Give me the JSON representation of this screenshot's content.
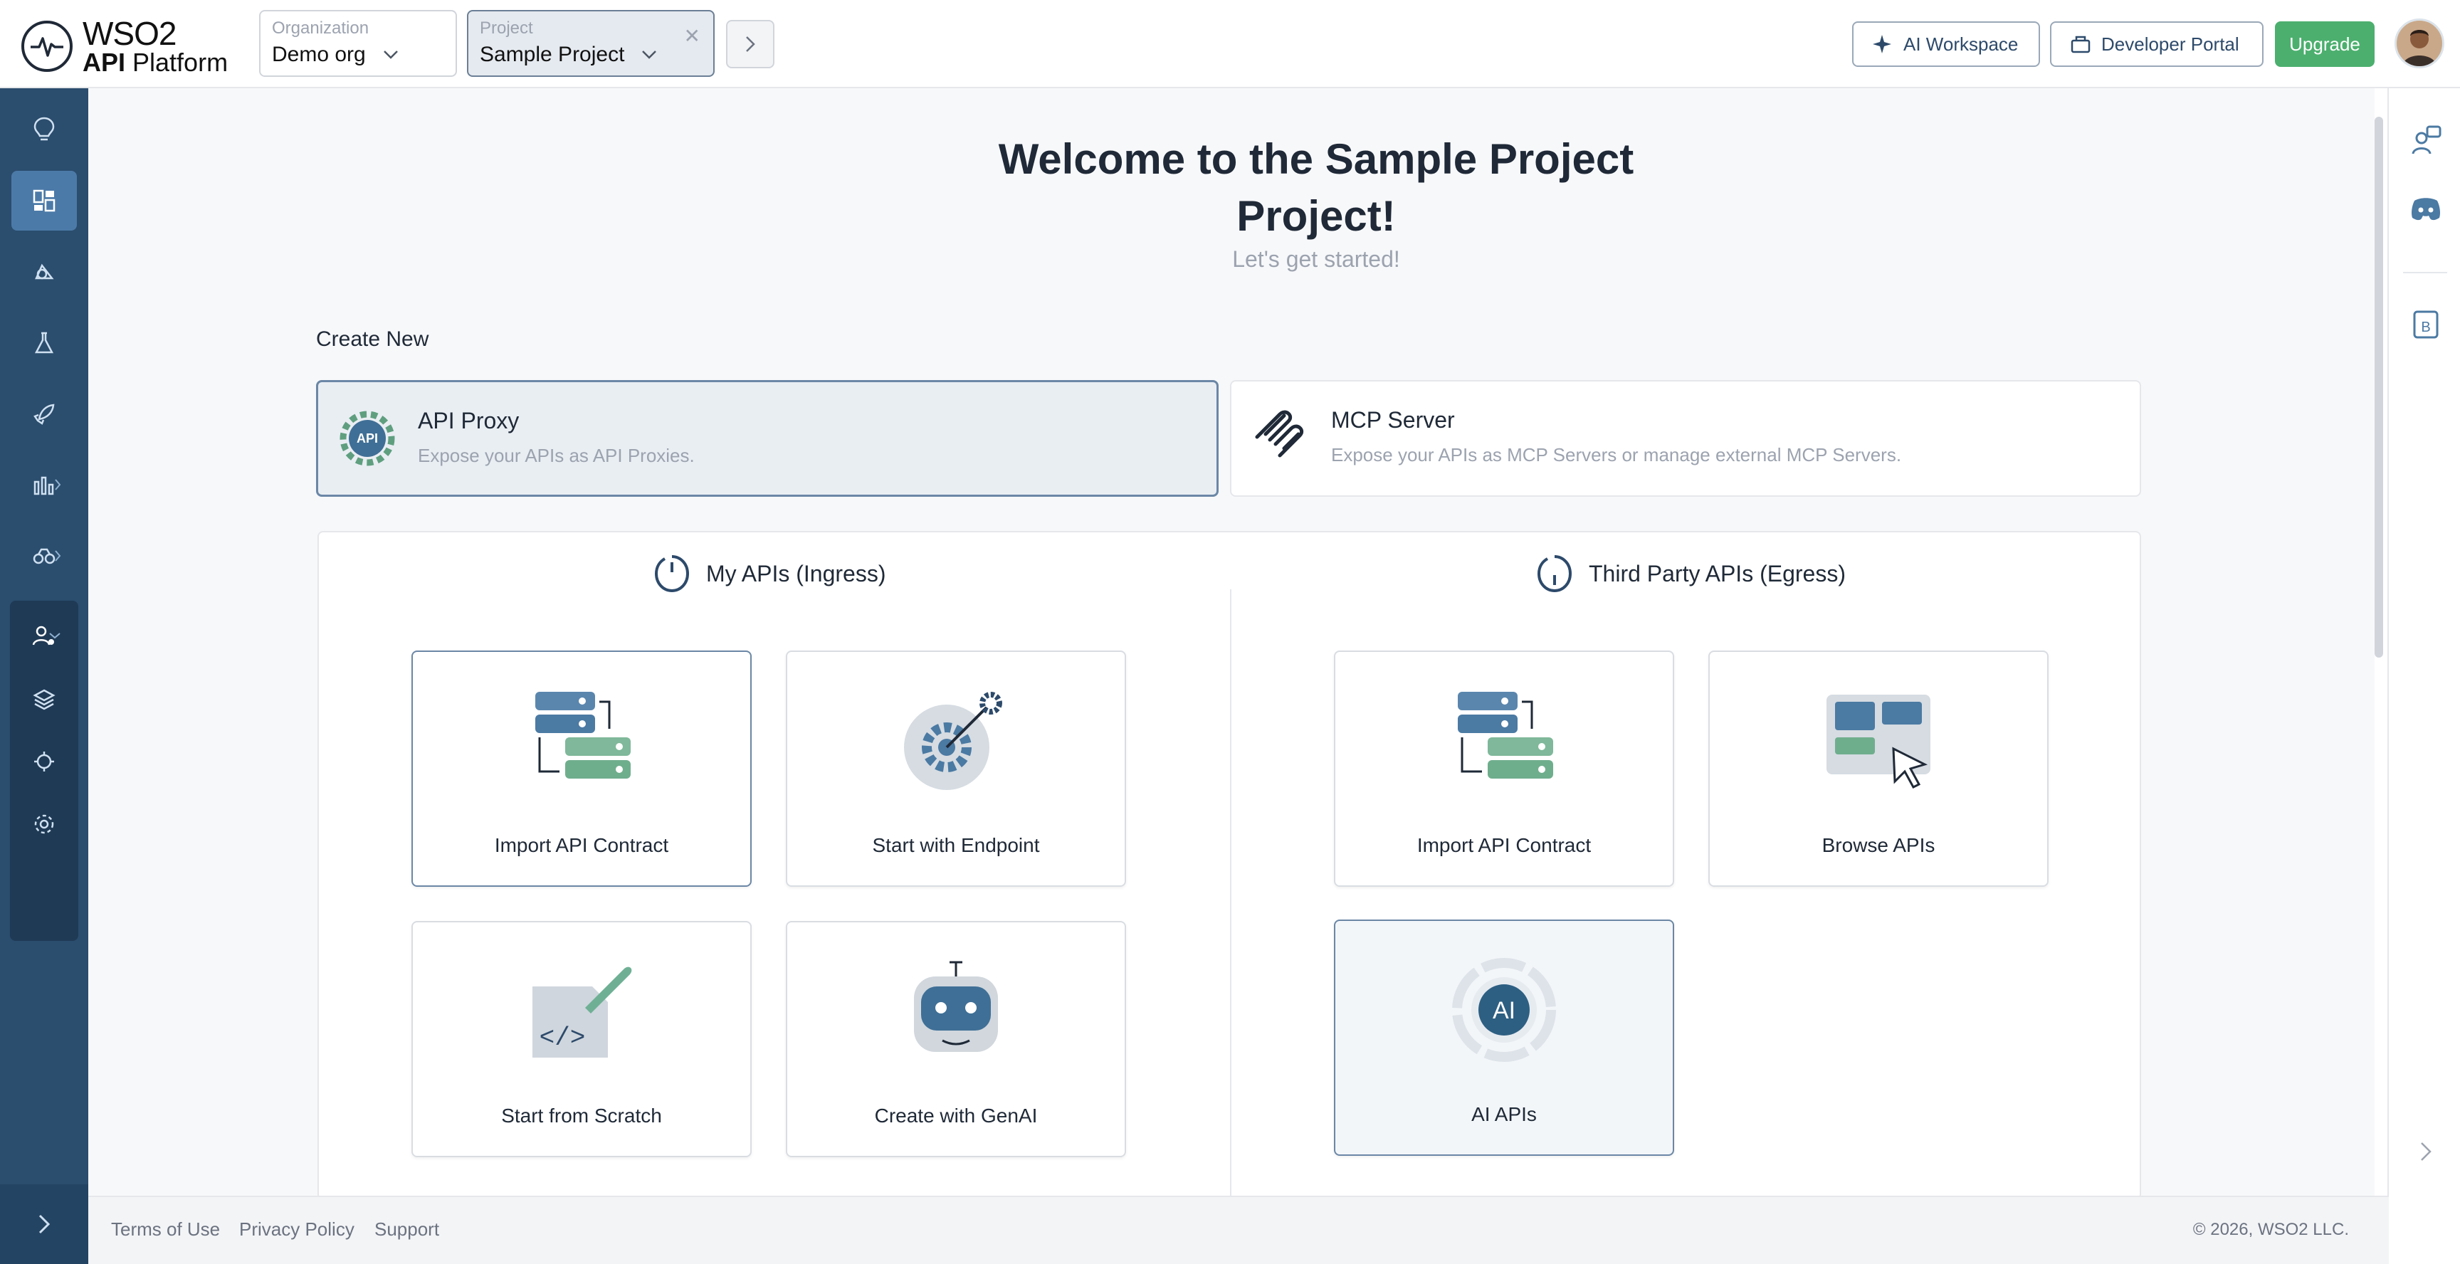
{
  "brand": {
    "name_line1": "WSO2",
    "name_line2_bold": "API",
    "name_line2_rest": " Platform"
  },
  "header": {
    "org_label": "Organization",
    "org_value": "Demo org",
    "project_label": "Project",
    "project_value": "Sample Project",
    "ai_workspace": "AI Workspace",
    "developer_portal": "Developer Portal",
    "upgrade": "Upgrade"
  },
  "colors": {
    "sidebar": "#2b4d6e",
    "accent": "#4c7aa8",
    "upgrade": "#4caf6e"
  },
  "welcome": {
    "title_line1": "Welcome to the Sample Project",
    "title_line2": "Project!",
    "subtitle": "Let's get started!"
  },
  "create_new": {
    "heading": "Create New",
    "api_proxy": {
      "title": "API Proxy",
      "desc": "Expose your APIs as API Proxies.",
      "badge": "API"
    },
    "mcp_server": {
      "title": "MCP Server",
      "desc": "Expose your APIs as MCP Servers or manage external MCP Servers."
    }
  },
  "ingress": {
    "heading": "My APIs (Ingress)",
    "options": [
      "Import API Contract",
      "Start with Endpoint",
      "Start from Scratch",
      "Create with GenAI"
    ]
  },
  "egress": {
    "heading": "Third Party APIs (Egress)",
    "options": [
      "Import API Contract",
      "Browse APIs",
      "AI APIs"
    ],
    "ai_badge": "AI"
  },
  "footer": {
    "terms": "Terms of Use",
    "privacy": "Privacy Policy",
    "support": "Support",
    "copyright": "© 2026, WSO2 LLC."
  }
}
